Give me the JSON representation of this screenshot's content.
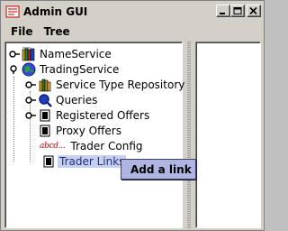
{
  "window": {
    "title": "Admin GUI"
  },
  "menubar": {
    "items": [
      {
        "label": "File"
      },
      {
        "label": "Tree"
      }
    ]
  },
  "tree": {
    "nodes": [
      {
        "label": "NameService"
      },
      {
        "label": "TradingService"
      },
      {
        "label": "Service Type Repository"
      },
      {
        "label": "Queries"
      },
      {
        "label": "Registered Offers"
      },
      {
        "label": "Proxy Offers"
      },
      {
        "label": "Trader Config",
        "icon_text": "abcd..."
      },
      {
        "label": "Trader Links"
      }
    ]
  },
  "context_menu": {
    "items": [
      {
        "label": "Add a link"
      }
    ]
  },
  "colors": {
    "selection": "#c8d0f0",
    "popup": "#b0b4e0",
    "frame": "#d4d0c8"
  }
}
